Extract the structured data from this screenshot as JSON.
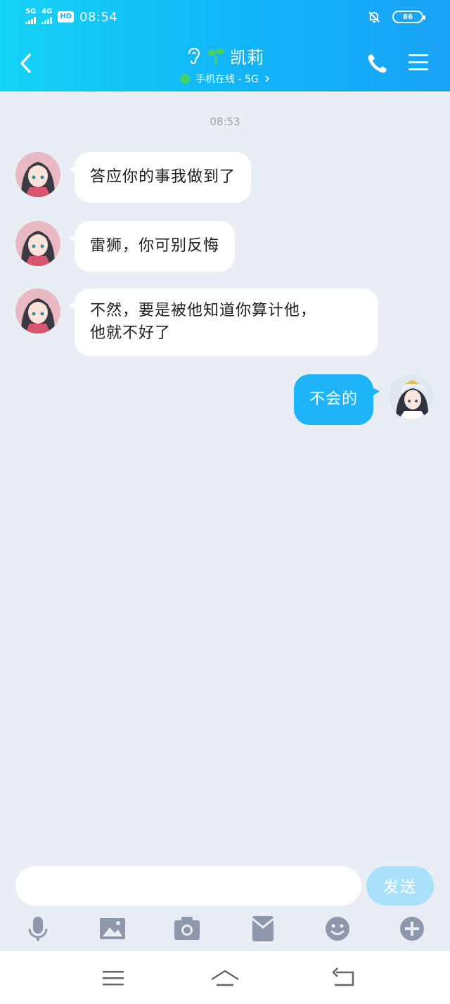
{
  "status_bar": {
    "signal1_label": "5G",
    "signal2_label": "4G",
    "hd_label": "HD",
    "time": "08:54",
    "battery": "86",
    "icons": [
      "bell-off-icon",
      "battery-icon"
    ]
  },
  "header": {
    "contact_name": "凯莉",
    "status_text": "手机在线 - 5G",
    "icons": [
      "back-icon",
      "ear-icon",
      "sprout-icon",
      "phone-icon",
      "menu-icon"
    ]
  },
  "chat": {
    "timestamp": "08:53",
    "messages": [
      {
        "side": "left",
        "text": "答应你的事我做到了"
      },
      {
        "side": "left",
        "text": "雷狮，你可别反悔"
      },
      {
        "side": "left",
        "line1": "不然，要是被他知道你算计他，",
        "line2": "他就不好了"
      },
      {
        "side": "right",
        "text": "不会的"
      }
    ]
  },
  "input": {
    "value": "",
    "placeholder": "",
    "send_label": "发送"
  },
  "toolbar": {
    "icons": [
      "microphone-icon",
      "image-icon",
      "camera-icon",
      "red-packet-icon",
      "emoji-icon",
      "plus-icon"
    ]
  },
  "navbar": {
    "icons": [
      "nav-menu-icon",
      "nav-home-icon",
      "nav-back-icon"
    ]
  },
  "colors": {
    "header_gradient_start": "#14d3f5",
    "header_gradient_end": "#1aa3f7",
    "background": "#e9edf4",
    "bubble_self": "#1eb4f6",
    "bubble_other": "#ffffff",
    "send_button": "#a9e1fb",
    "toolbar_icon": "#8e97ac"
  }
}
